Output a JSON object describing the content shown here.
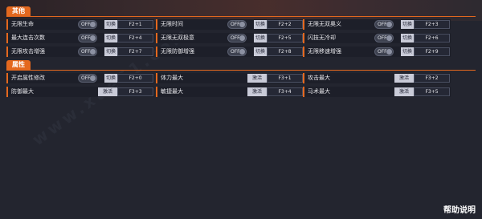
{
  "sections": {
    "other": {
      "title": "其他"
    },
    "attributes": {
      "title": "属性"
    }
  },
  "other_rows": [
    [
      {
        "label": "无限生命",
        "toggle": "OFF",
        "switch": "切换",
        "hotkey": "F2+1"
      },
      {
        "label": "无限时间",
        "toggle": "OFF",
        "switch": "切换",
        "hotkey": "F2+2"
      },
      {
        "label": "无限无双奥义",
        "toggle": "OFF",
        "switch": "切换",
        "hotkey": "F2+3"
      }
    ],
    [
      {
        "label": "最大连击次数",
        "toggle": "OFF",
        "switch": "切换",
        "hotkey": "F2+4"
      },
      {
        "label": "无限无双极意",
        "toggle": "OFF",
        "switch": "切换",
        "hotkey": "F2+5"
      },
      {
        "label": "闪技无冷却",
        "toggle": "OFF",
        "switch": "切换",
        "hotkey": "F2+6"
      }
    ],
    [
      {
        "label": "无限攻击增强",
        "toggle": "OFF",
        "switch": "切换",
        "hotkey": "F2+7"
      },
      {
        "label": "无限防御增强",
        "toggle": "OFF",
        "switch": "切换",
        "hotkey": "F2+8"
      },
      {
        "label": "无限移速增强",
        "toggle": "OFF",
        "switch": "切换",
        "hotkey": "F2+9"
      }
    ]
  ],
  "attr_rows": [
    [
      {
        "label": "开启属性修改",
        "toggle": "OFF",
        "switch": "切换",
        "hotkey": "F2+0"
      },
      {
        "label": "体力最大",
        "activate": "激活",
        "hotkey": "F3+1"
      },
      {
        "label": "攻击最大",
        "activate": "激活",
        "hotkey": "F3+2"
      }
    ],
    [
      {
        "label": "防御最大",
        "activate": "激活",
        "hotkey": "F3+3"
      },
      {
        "label": "敏捷最大",
        "activate": "激活",
        "hotkey": "F3+4"
      },
      {
        "label": "马术最大",
        "activate": "激活",
        "hotkey": "F3+5"
      }
    ]
  ],
  "footer": {
    "help": "帮助说明"
  },
  "watermark": "www.xue51.com",
  "colors": {
    "accent": "#e4681e",
    "background": "#23252f",
    "cell": "#1d1f29"
  }
}
